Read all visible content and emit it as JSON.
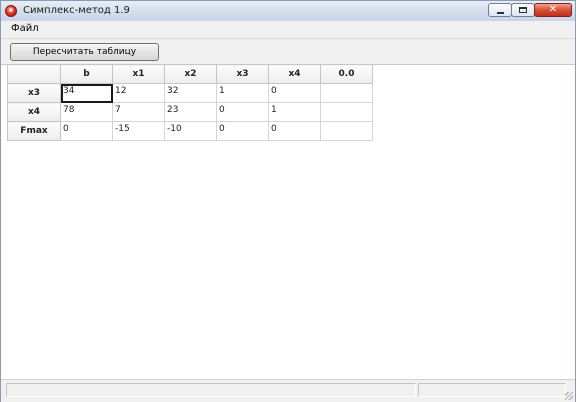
{
  "window": {
    "title": "Симплекс-метод 1.9"
  },
  "menu": {
    "file_label": "Файл"
  },
  "toolbar": {
    "recalculate_label": "Пересчитать таблицу"
  },
  "table": {
    "corner_label": "",
    "columns": [
      "b",
      "x1",
      "x2",
      "x3",
      "x4",
      "0.0"
    ],
    "rows": [
      {
        "label": "x3",
        "cells": [
          "34",
          "12",
          "32",
          "1",
          "0",
          ""
        ]
      },
      {
        "label": "x4",
        "cells": [
          "78",
          "7",
          "23",
          "0",
          "1",
          ""
        ]
      },
      {
        "label": "Fmax",
        "cells": [
          "0",
          "-15",
          "-10",
          "0",
          "0",
          ""
        ]
      }
    ]
  },
  "statusbar": {
    "left_text": "",
    "right_text": ""
  },
  "colors": {
    "titlebar": "#d3deed",
    "close_button": "#d54a33",
    "chrome": "#f0f0f0"
  }
}
